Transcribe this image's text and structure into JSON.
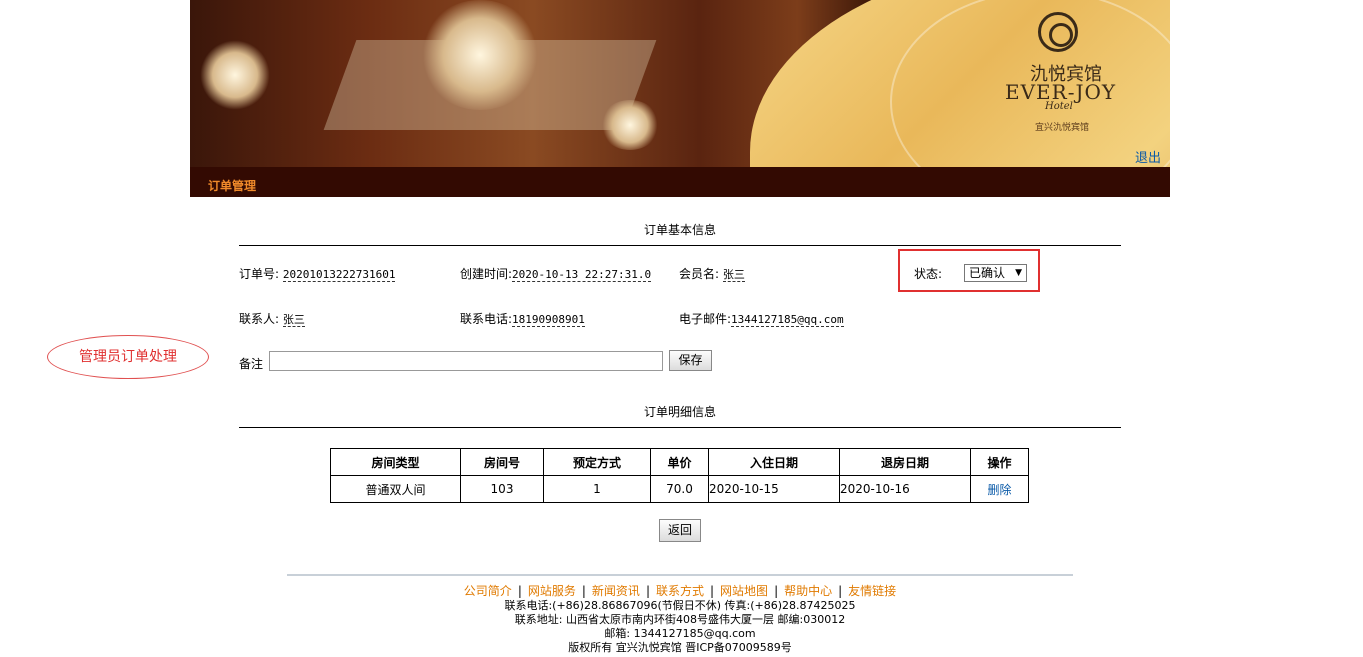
{
  "header": {
    "hotel_name_cn": "氿悦宾馆",
    "hotel_name_en": "EVER-JOY",
    "hotel_hotel": "Hotel",
    "hotel_subtitle": "宜兴氿悦宾馆",
    "logout": "退出"
  },
  "nav": {
    "title": "订单管理"
  },
  "order_info": {
    "section_title": "订单基本信息",
    "order_no_label": "订单号:",
    "order_no": "20201013222731601",
    "created_label": "创建时间:",
    "created": "2020-10-13 22:27:31.0",
    "member_label": "会员名:",
    "member": "张三",
    "status_label": "状态:",
    "status_value": "已确认",
    "contact_label": "联系人:",
    "contact": "张三",
    "phone_label": "联系电话:",
    "phone": "18190908901",
    "email_label": "电子邮件:",
    "email": "1344127185@qq.com",
    "note_label": "备注",
    "note_value": "",
    "save_label": "保存"
  },
  "annotation": {
    "text": "管理员订单处理"
  },
  "details": {
    "section_title": "订单明细信息",
    "columns": [
      "房间类型",
      "房间号",
      "预定方式",
      "单价",
      "入住日期",
      "退房日期",
      "操作"
    ],
    "rows": [
      {
        "room_type": "普通双人间",
        "room_no": "103",
        "booking_method": "1",
        "price": "70.0",
        "check_in": "2020-10-15",
        "check_out": "2020-10-16",
        "action": "删除"
      }
    ],
    "back_label": "返回"
  },
  "footer": {
    "links": [
      "公司简介",
      "网站服务",
      "新闻资讯",
      "联系方式",
      "网站地图",
      "帮助中心",
      "友情链接"
    ],
    "phone_line": "联系电话:(+86)28.86867096(节假日不休) 传真:(+86)28.87425025",
    "address_line": "联系地址: 山西省太原市南内环街408号盛伟大厦一层 邮编:030012",
    "email_line": "邮箱: 1344127185@qq.com",
    "copyright_line": "版权所有 宜兴氿悦宾馆 晋ICP备07009589号"
  },
  "colors": {
    "nav_bg": "#330a02",
    "nav_text": "#f08a2a",
    "link": "#0a5aa8",
    "footer_link": "#e07a00",
    "highlight": "#e03030"
  }
}
